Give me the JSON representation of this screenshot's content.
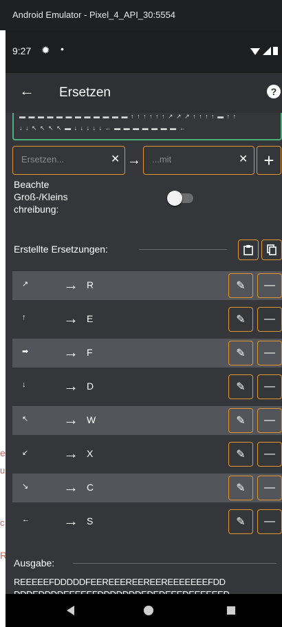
{
  "window": {
    "title": "Android Emulator - Pixel_4_API_30:5554"
  },
  "status_bar": {
    "time": "9:27"
  },
  "app_bar": {
    "title": "Ersetzen",
    "help_icon": "help-circle-icon",
    "back_icon": "back-arrow-icon"
  },
  "input": {
    "search_placeholder": "Ersetzen...",
    "replace_placeholder": "...mit",
    "add_label": "+"
  },
  "case_option": {
    "label": "Beachte Groß-/Kleins chreibung:"
  },
  "replacements": {
    "label": "Erstellte Ersetzungen:",
    "items": [
      {
        "from": "↗",
        "to": "R"
      },
      {
        "from": "↑",
        "to": "E"
      },
      {
        "from": "➡",
        "to": "F"
      },
      {
        "from": "↓",
        "to": "D"
      },
      {
        "from": "↖",
        "to": "W"
      },
      {
        "from": "↙",
        "to": "X"
      },
      {
        "from": "↘",
        "to": "C"
      },
      {
        "from": "←",
        "to": "S"
      }
    ]
  },
  "output": {
    "label": "Ausgabe:",
    "line1": "REEEEEFDDDDDFEEREEEREEREEREEEEEEEFDD",
    "line2": "DDDEDDDDEEEEEFDDDDDDDEDEDEEEDEEEEEED"
  },
  "top_text": {
    "line1": "▬ ▬ ▬ ▬ ▬ ▬ ▬ ▬ ▬ ▬ ▬ ▬ ↑ ↑ ↑ ↑ ↑ ↑ ↗ ↗ ↗ ↑ ↑ ↑ ↑ ▬ ↑ ↑",
    "line2": "↓ ↓ ↖ ↖ ↖ ↖ ▬ ↓ ↓ ↓ ↓ ↓ ← ▬ ▬ ▬ ▬ ▬ ▬ ▬ ←"
  },
  "side_letters": [
    "e",
    "u",
    "c",
    "R"
  ],
  "colors": {
    "accent": "#e3962b",
    "background": "#35363a",
    "row_alt": "#54555a"
  }
}
